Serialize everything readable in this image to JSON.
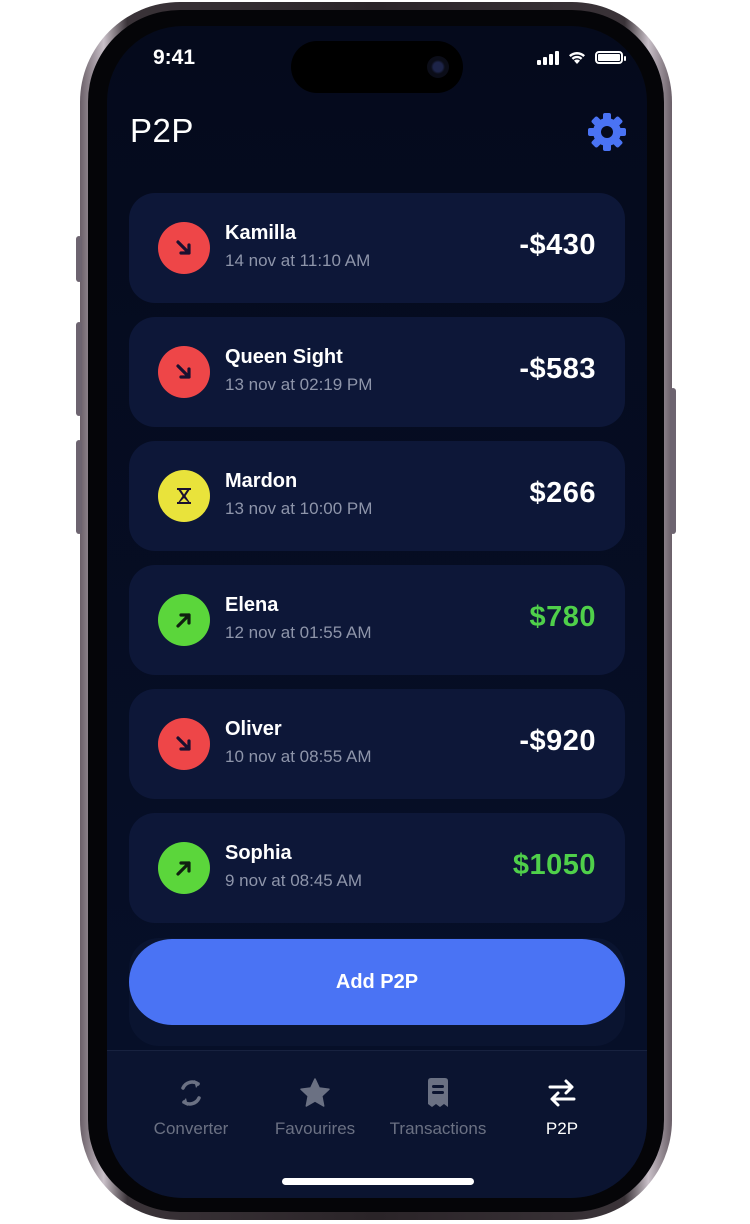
{
  "status_bar": {
    "time": "9:41"
  },
  "header": {
    "title": "P2P",
    "settings_icon": "gear-icon"
  },
  "colors": {
    "accent": "#4a73f4",
    "outgoing": "#ee4648",
    "incoming": "#5bd63b",
    "pending": "#e9e33b",
    "positive_amount": "#4fd04a"
  },
  "transactions": [
    {
      "name": "Kamilla",
      "date": "14 nov at 11:10 AM",
      "amount": "-$430",
      "direction": "outgoing",
      "icon": "arrow-down-right-icon"
    },
    {
      "name": "Queen Sight",
      "date": "13 nov at 02:19 PM",
      "amount": "-$583",
      "direction": "outgoing",
      "icon": "arrow-down-right-icon"
    },
    {
      "name": "Mardon",
      "date": "13 nov at 10:00 PM",
      "amount": "$266",
      "direction": "pending",
      "icon": "hourglass-icon"
    },
    {
      "name": "Elena",
      "date": "12 nov at 01:55 AM",
      "amount": "$780",
      "direction": "incoming",
      "icon": "arrow-up-right-icon"
    },
    {
      "name": "Oliver",
      "date": "10 nov at 08:55 AM",
      "amount": "-$920",
      "direction": "outgoing",
      "icon": "arrow-down-right-icon"
    },
    {
      "name": "Sophia",
      "date": "9 nov at 08:45 AM",
      "amount": "$1050",
      "direction": "incoming",
      "icon": "arrow-up-right-icon"
    }
  ],
  "add_button": {
    "label": "Add P2P"
  },
  "tabbar": {
    "tabs": [
      {
        "label": "Converter",
        "icon": "refresh-icon",
        "active": false
      },
      {
        "label": "Favourires",
        "icon": "star-icon",
        "active": false
      },
      {
        "label": "Transactions",
        "icon": "receipt-icon",
        "active": false
      },
      {
        "label": "P2P",
        "icon": "swap-arrows-icon",
        "active": true
      }
    ]
  }
}
